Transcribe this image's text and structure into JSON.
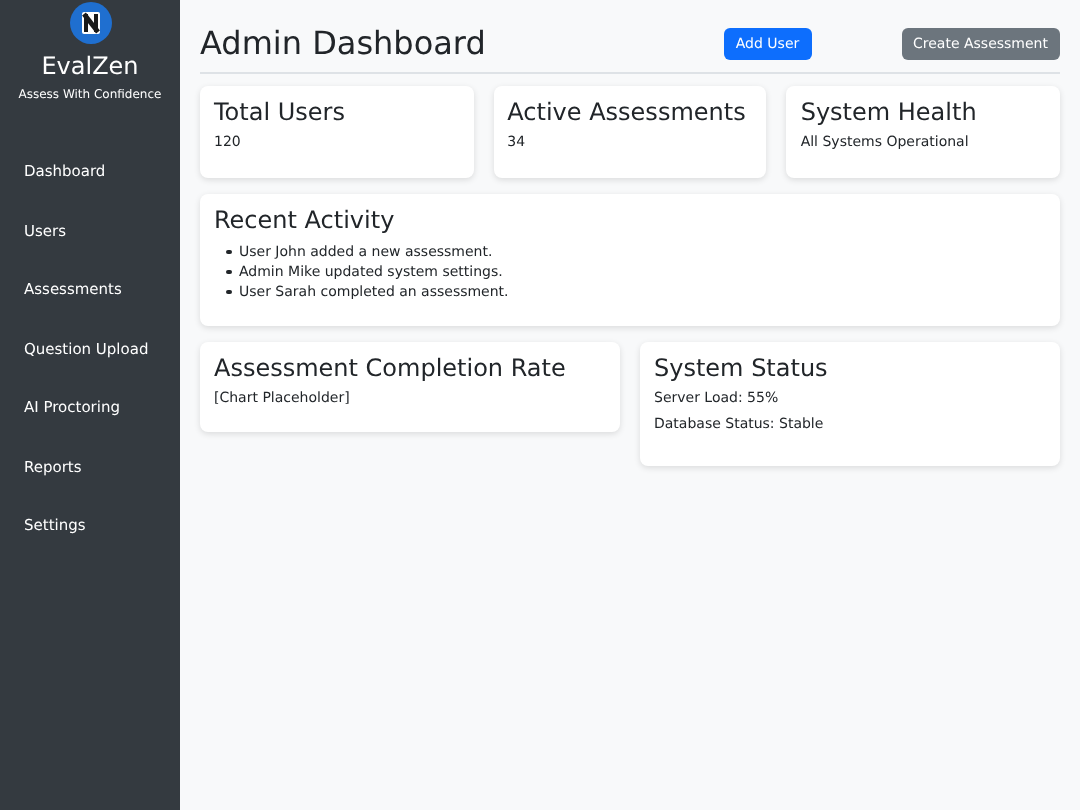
{
  "sidebar": {
    "brand": "EvalZen",
    "tagline": "Assess With Confidence",
    "items": [
      {
        "label": "Dashboard"
      },
      {
        "label": "Users"
      },
      {
        "label": "Assessments"
      },
      {
        "label": "Question Upload"
      },
      {
        "label": "AI Proctoring"
      },
      {
        "label": "Reports"
      },
      {
        "label": "Settings"
      }
    ]
  },
  "header": {
    "title": "Admin Dashboard",
    "buttons": [
      {
        "label": "Add User",
        "kind": "primary"
      },
      {
        "label": "Create Assessment",
        "kind": "secondary"
      }
    ]
  },
  "stats": [
    {
      "title": "Total Users",
      "value": "120"
    },
    {
      "title": "Active Assessments",
      "value": "34"
    },
    {
      "title": "System Health",
      "value": "All Systems Operational"
    }
  ],
  "recent_activity": {
    "title": "Recent Activity",
    "items": [
      "User John added a new assessment.",
      "Admin Mike updated system settings.",
      "User Sarah completed an assessment."
    ]
  },
  "completion": {
    "title": "Assessment Completion Rate",
    "body": "[Chart Placeholder]"
  },
  "system_status": {
    "title": "System Status",
    "lines": [
      "Server Load: 55%",
      "Database Status: Stable"
    ]
  }
}
